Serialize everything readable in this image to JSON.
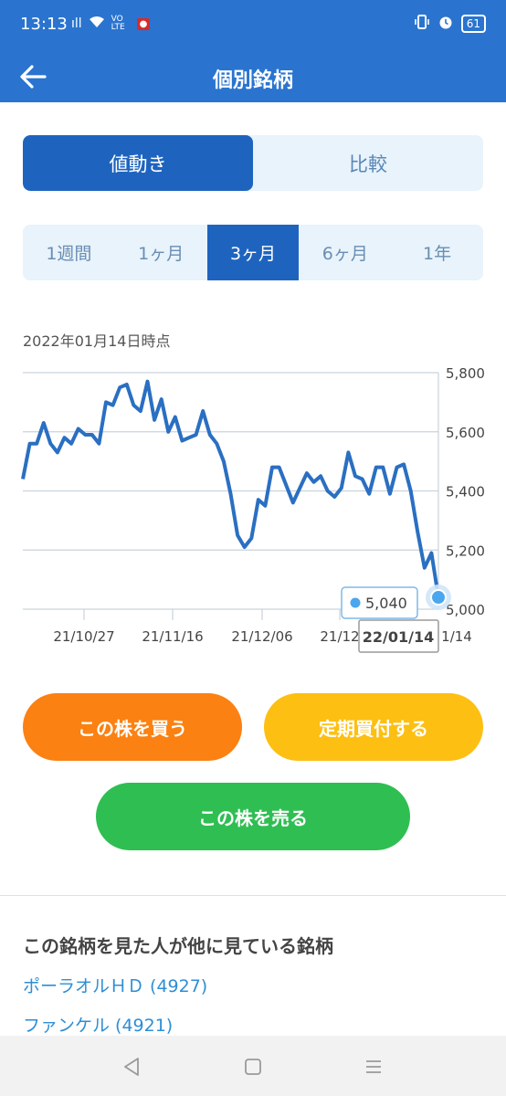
{
  "status_bar": {
    "time": "13:13",
    "signal": "ıll",
    "network": "VO LTE",
    "battery": "61"
  },
  "app_bar": {
    "title": "個別銘柄"
  },
  "view_tabs": [
    "値動き",
    "比較"
  ],
  "period_tabs": [
    "1週間",
    "1ヶ月",
    "3ヶ月",
    "6ヶ月",
    "1年"
  ],
  "active_period": "3ヶ月",
  "as_of": "2022年01月14日時点",
  "chart_data": {
    "type": "line",
    "x_ticks": [
      "21/10/27",
      "21/11/16",
      "21/12/06",
      "21/12",
      "1/14"
    ],
    "y_ticks": [
      "5,800",
      "5,600",
      "5,400",
      "5,200",
      "5,000"
    ],
    "ylim": [
      5000,
      5800
    ],
    "series": [
      {
        "values": [
          5440,
          5560,
          5560,
          5630,
          5560,
          5530,
          5580,
          5560,
          5610,
          5590,
          5590,
          5560,
          5700,
          5690,
          5750,
          5760,
          5690,
          5670,
          5770,
          5640,
          5710,
          5600,
          5650,
          5570,
          5580,
          5590,
          5670,
          5590,
          5560,
          5500,
          5390,
          5250,
          5210,
          5240,
          5370,
          5350,
          5480,
          5480,
          5420,
          5360,
          5410,
          5460,
          5430,
          5450,
          5400,
          5380,
          5410,
          5530,
          5450,
          5440,
          5390,
          5480,
          5480,
          5390,
          5480,
          5490,
          5400,
          5260,
          5140,
          5190,
          5040
        ]
      }
    ],
    "tooltip": {
      "value": "5,040",
      "date": "22/01/14"
    },
    "color": "#2a6fc2"
  },
  "buttons": {
    "buy": "この株を買う",
    "plan": "定期買付する",
    "sell": "この株を売る"
  },
  "related": {
    "title": "この銘柄を見た人が他に見ている銘柄",
    "items": [
      "ポーラオルＨＤ (4927)",
      "ファンケル (4921)"
    ]
  }
}
